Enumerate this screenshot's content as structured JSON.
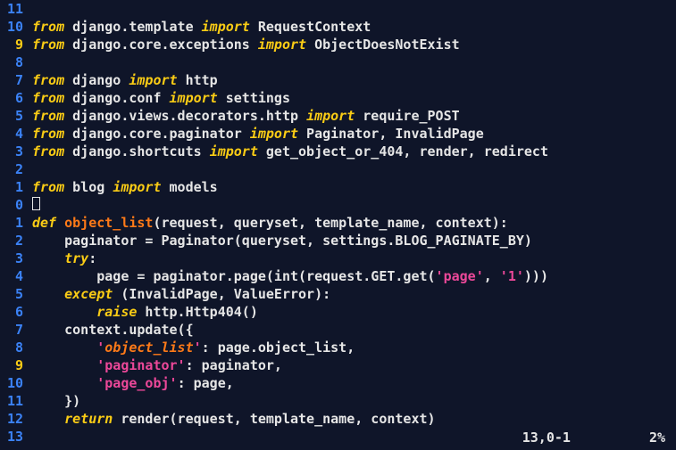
{
  "lines": [
    {
      "num": "11",
      "numClass": "ln-blue",
      "segs": []
    },
    {
      "num": "10",
      "numClass": "ln-blue",
      "segs": [
        {
          "t": "from",
          "c": "tok-kw-it"
        },
        {
          "t": " django.template ",
          "c": "tok-default"
        },
        {
          "t": "import",
          "c": "tok-kw-it"
        },
        {
          "t": " RequestContext",
          "c": "tok-default"
        }
      ]
    },
    {
      "num": "9",
      "numClass": "ln-yellow",
      "segs": [
        {
          "t": "from",
          "c": "tok-kw-it"
        },
        {
          "t": " django.core.exceptions ",
          "c": "tok-default"
        },
        {
          "t": "import",
          "c": "tok-kw-it"
        },
        {
          "t": " ObjectDoesNotExist",
          "c": "tok-default"
        }
      ]
    },
    {
      "num": "8",
      "numClass": "ln-blue",
      "segs": []
    },
    {
      "num": "7",
      "numClass": "ln-blue",
      "segs": [
        {
          "t": "from",
          "c": "tok-kw-it"
        },
        {
          "t": " django ",
          "c": "tok-default"
        },
        {
          "t": "import",
          "c": "tok-kw-it"
        },
        {
          "t": " http",
          "c": "tok-default"
        }
      ]
    },
    {
      "num": "6",
      "numClass": "ln-blue",
      "segs": [
        {
          "t": "from",
          "c": "tok-kw-it"
        },
        {
          "t": " django.conf ",
          "c": "tok-default"
        },
        {
          "t": "import",
          "c": "tok-kw-it"
        },
        {
          "t": " settings",
          "c": "tok-default"
        }
      ]
    },
    {
      "num": "5",
      "numClass": "ln-blue",
      "segs": [
        {
          "t": "from",
          "c": "tok-kw-it"
        },
        {
          "t": " django.views.decorators.http ",
          "c": "tok-default"
        },
        {
          "t": "import",
          "c": "tok-kw-it"
        },
        {
          "t": " require_POST",
          "c": "tok-default"
        }
      ]
    },
    {
      "num": "4",
      "numClass": "ln-blue",
      "segs": [
        {
          "t": "from",
          "c": "tok-kw-it"
        },
        {
          "t": " django.core.paginator ",
          "c": "tok-default"
        },
        {
          "t": "import",
          "c": "tok-kw-it"
        },
        {
          "t": " Paginator, InvalidPage",
          "c": "tok-default"
        }
      ]
    },
    {
      "num": "3",
      "numClass": "ln-blue",
      "segs": [
        {
          "t": "from",
          "c": "tok-kw-it"
        },
        {
          "t": " django.shortcuts ",
          "c": "tok-default"
        },
        {
          "t": "import",
          "c": "tok-kw-it"
        },
        {
          "t": " get_object_or_404, render, redirect",
          "c": "tok-default"
        }
      ]
    },
    {
      "num": "2",
      "numClass": "ln-blue",
      "segs": []
    },
    {
      "num": "1",
      "numClass": "ln-blue",
      "segs": [
        {
          "t": "from",
          "c": "tok-kw-it"
        },
        {
          "t": " blog ",
          "c": "tok-default"
        },
        {
          "t": "import",
          "c": "tok-kw-it"
        },
        {
          "t": " models",
          "c": "tok-default"
        }
      ]
    },
    {
      "num": "0",
      "numClass": "ln-blue",
      "cursor": true,
      "segs": []
    },
    {
      "num": "1",
      "numClass": "ln-blue",
      "segs": [
        {
          "t": "def",
          "c": "tok-kw-it"
        },
        {
          "t": " ",
          "c": "tok-default"
        },
        {
          "t": "object_list",
          "c": "tok-func"
        },
        {
          "t": "(request, queryset, template_name, context):",
          "c": "tok-default"
        }
      ]
    },
    {
      "num": "2",
      "numClass": "ln-blue",
      "segs": [
        {
          "t": "    paginator = Paginator(queryset, settings.BLOG_PAGINATE_BY)",
          "c": "tok-default"
        }
      ]
    },
    {
      "num": "3",
      "numClass": "ln-blue",
      "segs": [
        {
          "t": "    ",
          "c": "tok-default"
        },
        {
          "t": "try",
          "c": "tok-kw-it"
        },
        {
          "t": ":",
          "c": "tok-default"
        }
      ]
    },
    {
      "num": "4",
      "numClass": "ln-blue",
      "segs": [
        {
          "t": "        page = paginator.page(int(request.GET.get(",
          "c": "tok-default"
        },
        {
          "t": "'page'",
          "c": "tok-str"
        },
        {
          "t": ", ",
          "c": "tok-default"
        },
        {
          "t": "'1'",
          "c": "tok-str"
        },
        {
          "t": ")))",
          "c": "tok-default"
        }
      ]
    },
    {
      "num": "5",
      "numClass": "ln-blue",
      "segs": [
        {
          "t": "    ",
          "c": "tok-default"
        },
        {
          "t": "except",
          "c": "tok-kw-it"
        },
        {
          "t": " (InvalidPage, ValueError):",
          "c": "tok-default"
        }
      ]
    },
    {
      "num": "6",
      "numClass": "ln-blue",
      "segs": [
        {
          "t": "        ",
          "c": "tok-default"
        },
        {
          "t": "raise",
          "c": "tok-kw-it"
        },
        {
          "t": " http.Http404()",
          "c": "tok-default"
        }
      ]
    },
    {
      "num": "7",
      "numClass": "ln-blue",
      "segs": [
        {
          "t": "    context.update({",
          "c": "tok-default"
        }
      ]
    },
    {
      "num": "8",
      "numClass": "ln-blue",
      "segs": [
        {
          "t": "        ",
          "c": "tok-default"
        },
        {
          "t": "'",
          "c": "tok-str"
        },
        {
          "t": "object_list",
          "c": "tok-funcit"
        },
        {
          "t": "'",
          "c": "tok-str"
        },
        {
          "t": ": page.object_list,",
          "c": "tok-default"
        }
      ]
    },
    {
      "num": "9",
      "numClass": "ln-yellow",
      "segs": [
        {
          "t": "        ",
          "c": "tok-default"
        },
        {
          "t": "'paginator'",
          "c": "tok-str"
        },
        {
          "t": ": paginator,",
          "c": "tok-default"
        }
      ]
    },
    {
      "num": "10",
      "numClass": "ln-blue",
      "segs": [
        {
          "t": "        ",
          "c": "tok-default"
        },
        {
          "t": "'page_obj'",
          "c": "tok-str"
        },
        {
          "t": ": page,",
          "c": "tok-default"
        }
      ]
    },
    {
      "num": "11",
      "numClass": "ln-blue",
      "segs": [
        {
          "t": "    })",
          "c": "tok-default"
        }
      ]
    },
    {
      "num": "12",
      "numClass": "ln-blue",
      "segs": [
        {
          "t": "    ",
          "c": "tok-default"
        },
        {
          "t": "return",
          "c": "tok-kw-it"
        },
        {
          "t": " render(request, template_name, context)",
          "c": "tok-default"
        }
      ]
    },
    {
      "num": "13",
      "numClass": "ln-blue",
      "segs": []
    }
  ],
  "status": {
    "position": "13,0-1",
    "percent": "2%"
  }
}
